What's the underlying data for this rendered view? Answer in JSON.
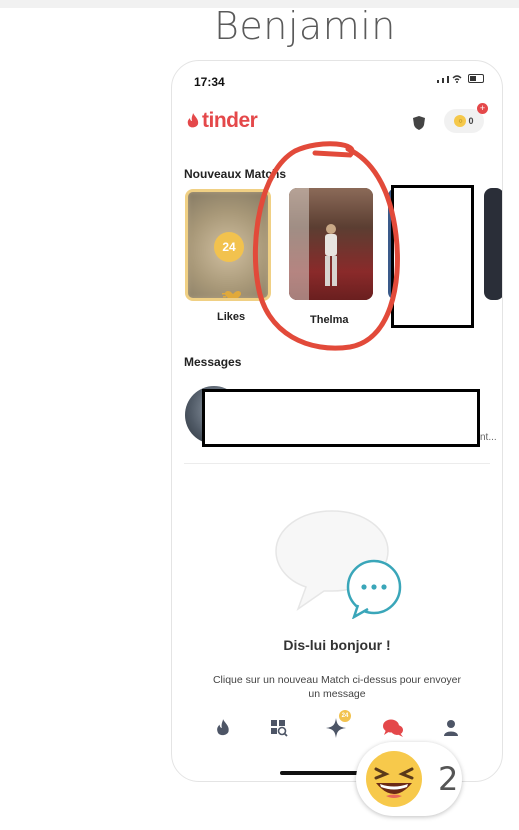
{
  "post": {
    "title": "Benjamin"
  },
  "status_bar": {
    "time": "17:34"
  },
  "app": {
    "logo_text": "tinder",
    "brand_color": "#e4484a",
    "boost_count": "0"
  },
  "new_matches": {
    "title": "Nouveaux Matchs",
    "likes": {
      "count": "24",
      "label": "Likes"
    },
    "matches": [
      {
        "name": "Thelma"
      }
    ]
  },
  "messages": {
    "title": "Messages",
    "preview_tail": "nt..."
  },
  "empty_state": {
    "title": "Dis-lui bonjour !",
    "body": "Clique sur un nouveau Match ci-dessus pour envoyer un message"
  },
  "nav": {
    "items": [
      "flame-icon",
      "explore-icon",
      "sparkle-icon",
      "chat-icon",
      "profile-icon"
    ],
    "active": "chat-icon",
    "sparkle_badge": "24"
  },
  "reaction": {
    "emoji": "laughing-emoji",
    "count": "2"
  }
}
